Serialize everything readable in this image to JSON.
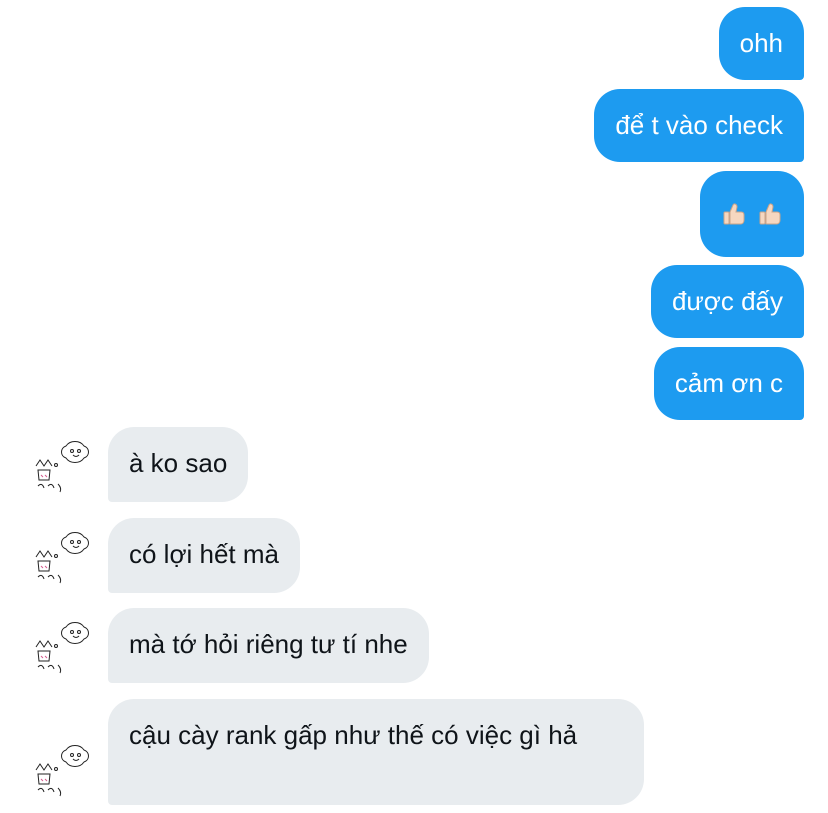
{
  "messages": {
    "outgoing": [
      {
        "text": "ohh"
      },
      {
        "text": "để t vào check"
      },
      {
        "emoji": "thumbs-up thumbs-up"
      },
      {
        "text": "được đấy"
      },
      {
        "text": "cảm ơn c"
      }
    ],
    "incoming": [
      {
        "text": "à ko sao"
      },
      {
        "text": "có lợi hết mà"
      },
      {
        "text": "mà tớ hỏi riêng tư tí nhe"
      },
      {
        "text": "cậu cày rank gấp như thế có việc gì hả"
      }
    ]
  },
  "colors": {
    "outgoing_bubble": "#1d9bf0",
    "incoming_bubble": "#e8ecef",
    "incoming_text": "#0f1419"
  },
  "icons": {
    "avatar": "hand-drawn-doodle-avatar",
    "reaction": "thumbs-up-icon"
  }
}
